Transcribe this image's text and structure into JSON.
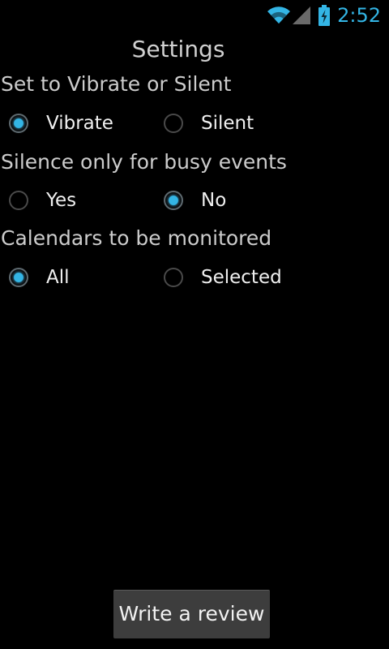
{
  "status_bar": {
    "time": "2:52",
    "accent_color": "#33b5e5",
    "icons": [
      "wifi-icon",
      "signal-icon",
      "battery-charging-icon"
    ]
  },
  "page": {
    "title": "Settings"
  },
  "sections": [
    {
      "label": "Set to Vibrate or Silent",
      "options": [
        {
          "label": "Vibrate",
          "checked": true
        },
        {
          "label": "Silent",
          "checked": false
        }
      ]
    },
    {
      "label": "Silence only for busy events",
      "options": [
        {
          "label": "Yes",
          "checked": false
        },
        {
          "label": "No",
          "checked": true
        }
      ]
    },
    {
      "label": "Calendars to be monitored",
      "options": [
        {
          "label": "All",
          "checked": true
        },
        {
          "label": "Selected",
          "checked": false
        }
      ]
    }
  ],
  "review_button": {
    "label": "Write a review"
  }
}
